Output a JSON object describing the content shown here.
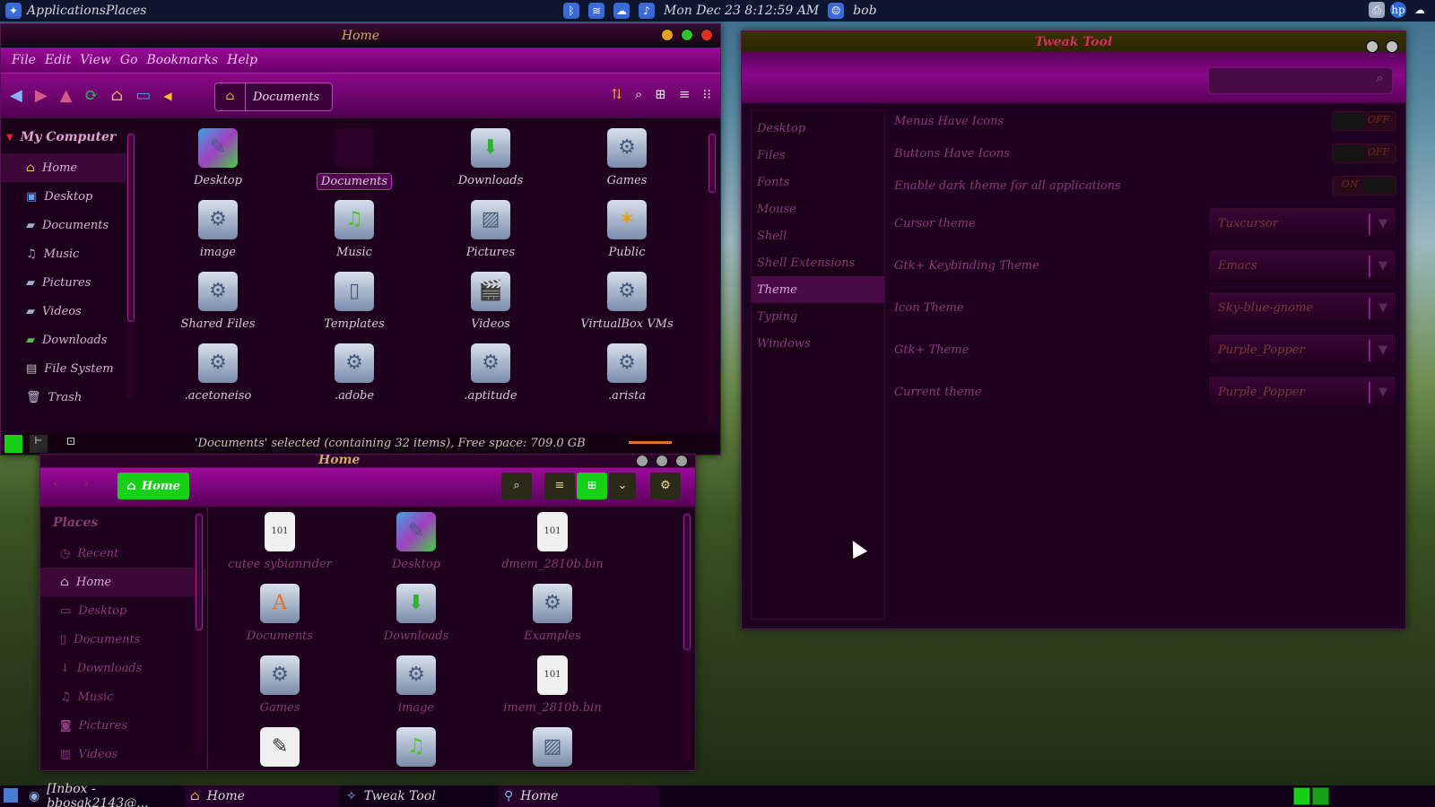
{
  "top_panel": {
    "menu_label": "ApplicationsPlaces",
    "clock": "Mon Dec 23   8:12:59 AM",
    "user": "bob",
    "icons": [
      "bluetooth-icon",
      "network-icon",
      "weather-icon",
      "volume-icon",
      "hp-icon"
    ]
  },
  "caja": {
    "title": "Home",
    "menu": [
      "File",
      "Edit",
      "View",
      "Go",
      "Bookmarks",
      "Help"
    ],
    "breadcrumb": "Documents",
    "sidebar_header": "My Computer",
    "sidebar": [
      "Home",
      "Desktop",
      "Documents",
      "Music",
      "Pictures",
      "Videos",
      "Downloads",
      "File System",
      "Trash"
    ],
    "files": [
      "Desktop",
      "Documents",
      "Downloads",
      "Games",
      "image",
      "Music",
      "Pictures",
      "Public",
      "Shared Files",
      "Templates",
      "Videos",
      "VirtualBox VMs",
      ".acetoneiso",
      ".adobe",
      ".aptitude",
      ".arista"
    ],
    "selected_file": "Documents",
    "status": "'Documents' selected (containing 32 items), Free space: 709.0 GB"
  },
  "nautilus": {
    "title": "Home",
    "path_button": "Home",
    "sidebar_header": "Places",
    "sidebar": [
      "Recent",
      "Home",
      "Desktop",
      "Documents",
      "Downloads",
      "Music",
      "Pictures",
      "Videos"
    ],
    "files": [
      "cutee sybianrider",
      "Desktop",
      "dmem_2810b.bin",
      "Documents",
      "Downloads",
      "Examples",
      "Games",
      "image",
      "imem_2810b.bin"
    ]
  },
  "tweak": {
    "title": "Tweak Tool",
    "categories": [
      "Desktop",
      "Files",
      "Fonts",
      "Mouse",
      "Shell",
      "Shell Extensions",
      "Theme",
      "Typing",
      "Windows"
    ],
    "selected_category": "Theme",
    "switches": [
      {
        "label": "Menus Have Icons",
        "state": "OFF"
      },
      {
        "label": "Buttons Have Icons",
        "state": "OFF"
      },
      {
        "label": "Enable dark theme for all applications",
        "state": "ON"
      }
    ],
    "combos": [
      {
        "label": "Cursor theme",
        "value": "Tuxcursor"
      },
      {
        "label": "Gtk+ Keybinding Theme",
        "value": "Emacs"
      },
      {
        "label": "Icon Theme",
        "value": "Sky-blue-gnome"
      },
      {
        "label": "Gtk+ Theme",
        "value": "Purple_Popper"
      },
      {
        "label": "Current theme",
        "value": "Purple_Popper"
      }
    ]
  },
  "taskbar": {
    "tasks": [
      "[Inbox - bbosak2143@...",
      "Home",
      "Tweak Tool",
      "Home"
    ]
  },
  "colors": {
    "accent": "#a010a0",
    "green": "#18d018",
    "title_text": "#d0a860"
  }
}
